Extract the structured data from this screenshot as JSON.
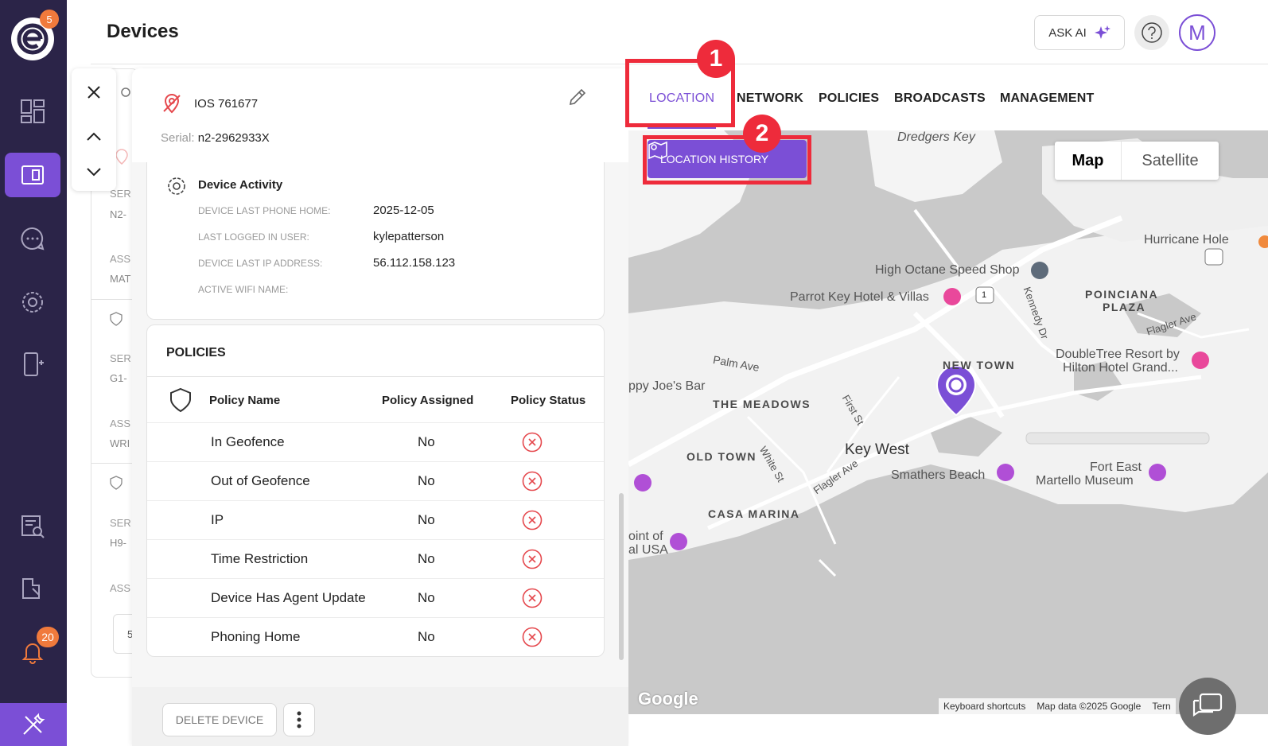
{
  "app": {
    "logo_badge": "5",
    "notifications_badge": "20",
    "page_title": "Devices",
    "ask_ai_label": "ASK AI",
    "avatar_initial": "M"
  },
  "background_list": {
    "labels": [
      "SER",
      "N2-",
      "ASS",
      "MAT",
      "SER",
      "G1-",
      "ASS",
      "WRI",
      "SER",
      "H9-",
      "ASS",
      "5"
    ]
  },
  "device": {
    "name": "IOS 761677",
    "serial_label": "Serial:",
    "serial_value": "n2-2962933X"
  },
  "activity": {
    "title": "Device Activity",
    "rows": [
      {
        "label": "DEVICE LAST PHONE HOME:",
        "value": "2025-12-05"
      },
      {
        "label": "LAST LOGGED IN USER:",
        "value": "kylepatterson"
      },
      {
        "label": "DEVICE LAST IP ADDRESS:",
        "value": "56.112.158.123"
      },
      {
        "label": "ACTIVE WIFI NAME:",
        "value": ""
      }
    ]
  },
  "policies": {
    "title": "POLICIES",
    "col_name": "Policy Name",
    "col_assigned": "Policy Assigned",
    "col_status": "Policy Status",
    "rows": [
      {
        "name": "In Geofence",
        "assigned": "No"
      },
      {
        "name": "Out of Geofence",
        "assigned": "No"
      },
      {
        "name": "IP",
        "assigned": "No"
      },
      {
        "name": "Time Restriction",
        "assigned": "No"
      },
      {
        "name": "Device Has Agent Update",
        "assigned": "No"
      },
      {
        "name": "Phoning Home",
        "assigned": "No"
      }
    ]
  },
  "footer": {
    "delete_label": "DELETE DEVICE"
  },
  "tabs": [
    {
      "label": "LOCATION",
      "active": true
    },
    {
      "label": "NETWORK",
      "active": false
    },
    {
      "label": "POLICIES",
      "active": false
    },
    {
      "label": "BROADCASTS",
      "active": false
    },
    {
      "label": "MANAGEMENT",
      "active": false
    }
  ],
  "map": {
    "location_history_label": "LOCATION HISTORY",
    "toggle_map": "Map",
    "toggle_satellite": "Satellite",
    "google": "Google",
    "attr_shortcuts": "Keyboard shortcuts",
    "attr_data": "Map data ©2025 Google",
    "attr_terms": "Tern",
    "labels": {
      "dredgers": "Dredgers Key",
      "hurricane": "Hurricane Hole",
      "speed_shop": "High Octane Speed Shop",
      "parrot": "Parrot Key Hotel & Villas",
      "poinciana_1": "POINCIANA",
      "poinciana_2": "PLAZA",
      "kennedy": "Kennedy Dr",
      "flagler_ave_1": "Flagler Ave",
      "palm_ave": "Palm Ave",
      "doubletree_1": "DoubleTree Resort by",
      "doubletree_2": "Hilton Hotel Grand...",
      "new_town": "NEW TOWN",
      "joes_bar": "ppy Joe's Bar",
      "meadows": "THE MEADOWS",
      "first_st": "First St",
      "key_west": "Key West",
      "old_town": "OLD TOWN",
      "white_st": "White St",
      "flagler_ave_2": "Flagler Ave",
      "smathers": "Smathers Beach",
      "fort_east_1": "Fort East",
      "fort_east_2": "Martello Museum",
      "casa_marina": "CASA MARINA",
      "point_of_1": "oint of",
      "point_of_2": "al USA",
      "route_1": "1"
    }
  },
  "annotations": {
    "one": "1",
    "two": "2"
  },
  "colors": {
    "sidebar": "#2b2448",
    "accent": "#7b4fd6",
    "badge": "#f07a3c",
    "annotation": "#ee2b3b",
    "status_fail": "#e5484d"
  }
}
